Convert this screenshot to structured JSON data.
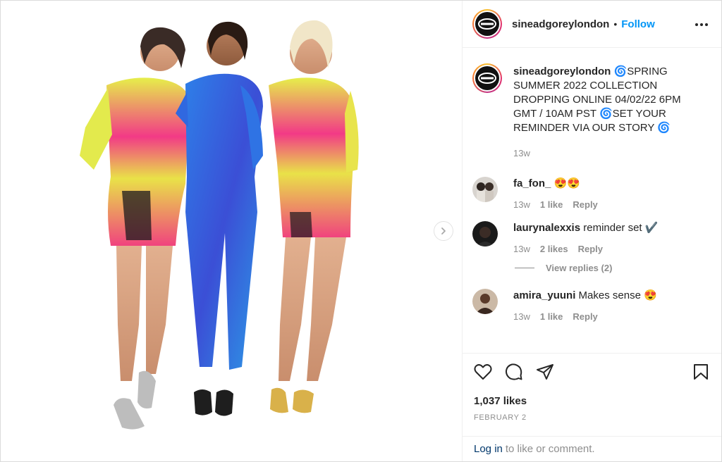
{
  "account": {
    "username": "sineadgoreylondon",
    "separator": "•",
    "follow_label": "Follow"
  },
  "caption": {
    "username": "sineadgoreylondon",
    "text": "🌀SPRING SUMMER 2022 COLLECTION DROPPING ONLINE 04/02/22 6PM GMT / 10AM PST 🌀SET YOUR REMINDER VIA OUR STORY 🌀",
    "time": "13w"
  },
  "comments": [
    {
      "username": "fa_fon_",
      "text": "😍😍",
      "time": "13w",
      "likes": "1 like",
      "reply": "Reply"
    },
    {
      "username": "laurynalexxis",
      "text": "reminder set ✔️",
      "time": "13w",
      "likes": "2 likes",
      "reply": "Reply",
      "view_replies": "View replies (2)"
    },
    {
      "username": "amira_yuuni",
      "text": "Makes sense 😍",
      "time": "13w",
      "likes": "1 like",
      "reply": "Reply"
    }
  ],
  "post": {
    "likes": "1,037 likes",
    "date": "FEBRUARY 2"
  },
  "login": {
    "link": "Log in",
    "text": "to like or comment."
  },
  "colors": {
    "accent": "#0095f6",
    "link": "#00376b",
    "muted": "#8e8e8e",
    "text": "#262626"
  },
  "icons": [
    "more-icon",
    "heart-icon",
    "comment-icon",
    "share-icon",
    "bookmark-icon",
    "chevron-right-icon"
  ]
}
